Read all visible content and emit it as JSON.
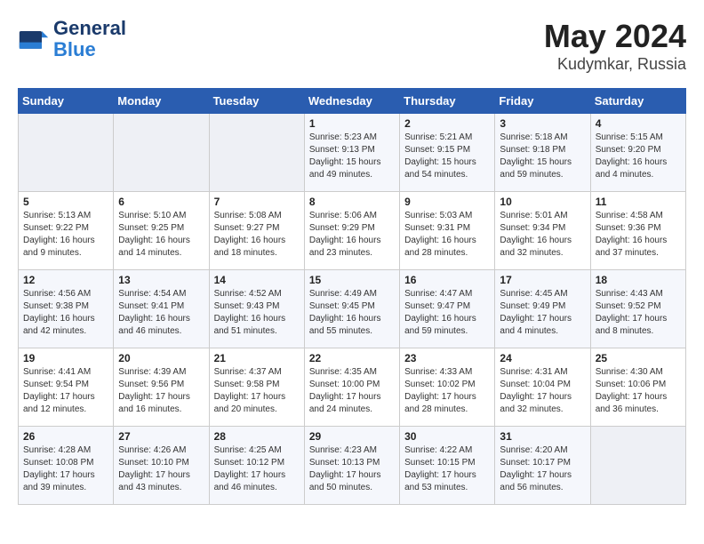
{
  "logo": {
    "text_general": "General",
    "text_blue": "Blue"
  },
  "header": {
    "month": "May 2024",
    "location": "Kudymkar, Russia"
  },
  "days_of_week": [
    "Sunday",
    "Monday",
    "Tuesday",
    "Wednesday",
    "Thursday",
    "Friday",
    "Saturday"
  ],
  "weeks": [
    [
      {
        "day": "",
        "info": ""
      },
      {
        "day": "",
        "info": ""
      },
      {
        "day": "",
        "info": ""
      },
      {
        "day": "1",
        "info": "Sunrise: 5:23 AM\nSunset: 9:13 PM\nDaylight: 15 hours\nand 49 minutes."
      },
      {
        "day": "2",
        "info": "Sunrise: 5:21 AM\nSunset: 9:15 PM\nDaylight: 15 hours\nand 54 minutes."
      },
      {
        "day": "3",
        "info": "Sunrise: 5:18 AM\nSunset: 9:18 PM\nDaylight: 15 hours\nand 59 minutes."
      },
      {
        "day": "4",
        "info": "Sunrise: 5:15 AM\nSunset: 9:20 PM\nDaylight: 16 hours\nand 4 minutes."
      }
    ],
    [
      {
        "day": "5",
        "info": "Sunrise: 5:13 AM\nSunset: 9:22 PM\nDaylight: 16 hours\nand 9 minutes."
      },
      {
        "day": "6",
        "info": "Sunrise: 5:10 AM\nSunset: 9:25 PM\nDaylight: 16 hours\nand 14 minutes."
      },
      {
        "day": "7",
        "info": "Sunrise: 5:08 AM\nSunset: 9:27 PM\nDaylight: 16 hours\nand 18 minutes."
      },
      {
        "day": "8",
        "info": "Sunrise: 5:06 AM\nSunset: 9:29 PM\nDaylight: 16 hours\nand 23 minutes."
      },
      {
        "day": "9",
        "info": "Sunrise: 5:03 AM\nSunset: 9:31 PM\nDaylight: 16 hours\nand 28 minutes."
      },
      {
        "day": "10",
        "info": "Sunrise: 5:01 AM\nSunset: 9:34 PM\nDaylight: 16 hours\nand 32 minutes."
      },
      {
        "day": "11",
        "info": "Sunrise: 4:58 AM\nSunset: 9:36 PM\nDaylight: 16 hours\nand 37 minutes."
      }
    ],
    [
      {
        "day": "12",
        "info": "Sunrise: 4:56 AM\nSunset: 9:38 PM\nDaylight: 16 hours\nand 42 minutes."
      },
      {
        "day": "13",
        "info": "Sunrise: 4:54 AM\nSunset: 9:41 PM\nDaylight: 16 hours\nand 46 minutes."
      },
      {
        "day": "14",
        "info": "Sunrise: 4:52 AM\nSunset: 9:43 PM\nDaylight: 16 hours\nand 51 minutes."
      },
      {
        "day": "15",
        "info": "Sunrise: 4:49 AM\nSunset: 9:45 PM\nDaylight: 16 hours\nand 55 minutes."
      },
      {
        "day": "16",
        "info": "Sunrise: 4:47 AM\nSunset: 9:47 PM\nDaylight: 16 hours\nand 59 minutes."
      },
      {
        "day": "17",
        "info": "Sunrise: 4:45 AM\nSunset: 9:49 PM\nDaylight: 17 hours\nand 4 minutes."
      },
      {
        "day": "18",
        "info": "Sunrise: 4:43 AM\nSunset: 9:52 PM\nDaylight: 17 hours\nand 8 minutes."
      }
    ],
    [
      {
        "day": "19",
        "info": "Sunrise: 4:41 AM\nSunset: 9:54 PM\nDaylight: 17 hours\nand 12 minutes."
      },
      {
        "day": "20",
        "info": "Sunrise: 4:39 AM\nSunset: 9:56 PM\nDaylight: 17 hours\nand 16 minutes."
      },
      {
        "day": "21",
        "info": "Sunrise: 4:37 AM\nSunset: 9:58 PM\nDaylight: 17 hours\nand 20 minutes."
      },
      {
        "day": "22",
        "info": "Sunrise: 4:35 AM\nSunset: 10:00 PM\nDaylight: 17 hours\nand 24 minutes."
      },
      {
        "day": "23",
        "info": "Sunrise: 4:33 AM\nSunset: 10:02 PM\nDaylight: 17 hours\nand 28 minutes."
      },
      {
        "day": "24",
        "info": "Sunrise: 4:31 AM\nSunset: 10:04 PM\nDaylight: 17 hours\nand 32 minutes."
      },
      {
        "day": "25",
        "info": "Sunrise: 4:30 AM\nSunset: 10:06 PM\nDaylight: 17 hours\nand 36 minutes."
      }
    ],
    [
      {
        "day": "26",
        "info": "Sunrise: 4:28 AM\nSunset: 10:08 PM\nDaylight: 17 hours\nand 39 minutes."
      },
      {
        "day": "27",
        "info": "Sunrise: 4:26 AM\nSunset: 10:10 PM\nDaylight: 17 hours\nand 43 minutes."
      },
      {
        "day": "28",
        "info": "Sunrise: 4:25 AM\nSunset: 10:12 PM\nDaylight: 17 hours\nand 46 minutes."
      },
      {
        "day": "29",
        "info": "Sunrise: 4:23 AM\nSunset: 10:13 PM\nDaylight: 17 hours\nand 50 minutes."
      },
      {
        "day": "30",
        "info": "Sunrise: 4:22 AM\nSunset: 10:15 PM\nDaylight: 17 hours\nand 53 minutes."
      },
      {
        "day": "31",
        "info": "Sunrise: 4:20 AM\nSunset: 10:17 PM\nDaylight: 17 hours\nand 56 minutes."
      },
      {
        "day": "",
        "info": ""
      }
    ]
  ]
}
